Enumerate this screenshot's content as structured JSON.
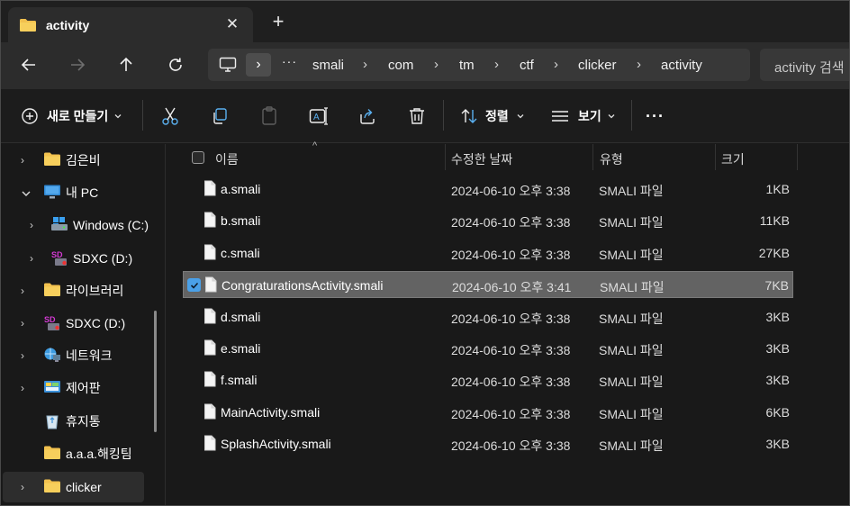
{
  "window": {
    "tab_title": "activity",
    "tab_close": "✕",
    "new_tab": "+"
  },
  "address": {
    "overflow": "···",
    "crumbs": [
      "smali",
      "com",
      "tm",
      "ctf",
      "clicker",
      "activity"
    ],
    "search_placeholder": "activity 검색"
  },
  "toolbar": {
    "new_label": "새로 만들기",
    "sort_label": "정렬",
    "view_label": "보기",
    "more": "···"
  },
  "sidebar": {
    "items": [
      {
        "label": "김은비"
      },
      {
        "label": "내 PC"
      },
      {
        "label": "Windows (C:)"
      },
      {
        "label": "SDXC (D:)"
      },
      {
        "label": "라이브러리"
      },
      {
        "label": "SDXC (D:)"
      },
      {
        "label": "네트워크"
      },
      {
        "label": "제어판"
      },
      {
        "label": "휴지통"
      },
      {
        "label": "a.a.a.해킹팀"
      },
      {
        "label": "clicker"
      }
    ]
  },
  "columns": {
    "name": "이름",
    "modified": "수정한 날짜",
    "type": "유형",
    "size": "크기"
  },
  "files": [
    {
      "name": "a.smali",
      "modified": "2024-06-10 오후 3:38",
      "type": "SMALI 파일",
      "size": "1KB",
      "selected": false
    },
    {
      "name": "b.smali",
      "modified": "2024-06-10 오후 3:38",
      "type": "SMALI 파일",
      "size": "11KB",
      "selected": false
    },
    {
      "name": "c.smali",
      "modified": "2024-06-10 오후 3:38",
      "type": "SMALI 파일",
      "size": "27KB",
      "selected": false
    },
    {
      "name": "CongraturationsActivity.smali",
      "modified": "2024-06-10 오후 3:41",
      "type": "SMALI 파일",
      "size": "7KB",
      "selected": true
    },
    {
      "name": "d.smali",
      "modified": "2024-06-10 오후 3:38",
      "type": "SMALI 파일",
      "size": "3KB",
      "selected": false
    },
    {
      "name": "e.smali",
      "modified": "2024-06-10 오후 3:38",
      "type": "SMALI 파일",
      "size": "3KB",
      "selected": false
    },
    {
      "name": "f.smali",
      "modified": "2024-06-10 오후 3:38",
      "type": "SMALI 파일",
      "size": "3KB",
      "selected": false
    },
    {
      "name": "MainActivity.smali",
      "modified": "2024-06-10 오후 3:38",
      "type": "SMALI 파일",
      "size": "6KB",
      "selected": false
    },
    {
      "name": "SplashActivity.smali",
      "modified": "2024-06-10 오후 3:38",
      "type": "SMALI 파일",
      "size": "3KB",
      "selected": false
    }
  ],
  "colors": {
    "accent": "#4aa0e8",
    "folder": "#f2c14e",
    "selection": "#636363"
  }
}
